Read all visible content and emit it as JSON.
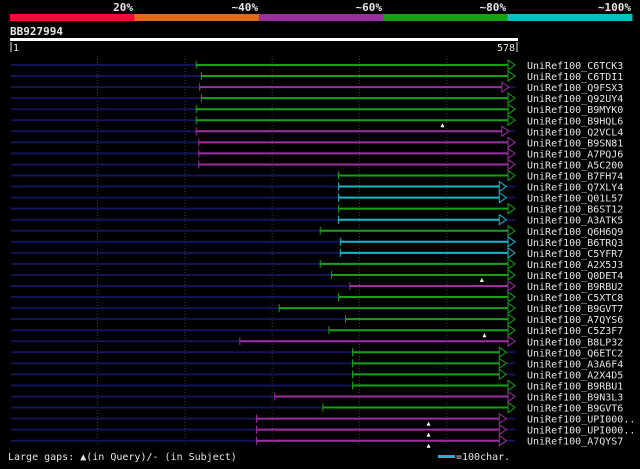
{
  "header": {
    "identity_ticks": [
      "20%",
      "~40%",
      "~60%",
      "~80%",
      "~100%"
    ],
    "identity_colors": [
      "#e8103a",
      "#e06c1c",
      "#9b2fa0",
      "#16a016",
      "#16b8c4"
    ],
    "query_id": "BB927994",
    "query_start": "1",
    "query_end": "578"
  },
  "footer": {
    "gaps_legend": "Large gaps: ▲(in Query)/- (in Subject)",
    "scale_legend": "=100char."
  },
  "colors": {
    "background": "#000000",
    "baseline": "#14145a",
    "grid": "#3a3a3a",
    "text": "#e6e6e6",
    "green": "#16a016",
    "purple": "#9b2fa0",
    "cyan": "#16b8c4"
  },
  "chart_data": {
    "type": "alignment",
    "query_length": 578,
    "x_range": [
      1,
      578
    ],
    "grid": true,
    "identity_bins": [
      "20%",
      "~40%",
      "~60%",
      "~80%",
      "~100%"
    ],
    "hits": [
      {
        "name": "UniRef100_C6TCK3",
        "start": 213,
        "end": 578,
        "color": "green",
        "gaps": []
      },
      {
        "name": "UniRef100_C6TDI1",
        "start": 219,
        "end": 578,
        "color": "green",
        "gaps": []
      },
      {
        "name": "UniRef100_Q9FSX3",
        "start": 217,
        "end": 571,
        "color": "purple",
        "gaps": []
      },
      {
        "name": "UniRef100_Q92UY4",
        "start": 219,
        "end": 578,
        "color": "green",
        "gaps": []
      },
      {
        "name": "UniRef100_B9MYK0",
        "start": 213,
        "end": 578,
        "color": "green",
        "gaps": []
      },
      {
        "name": "UniRef100_B9HQL6",
        "start": 213,
        "end": 578,
        "color": "green",
        "gaps": [
          495
        ]
      },
      {
        "name": "UniRef100_Q2VCL4",
        "start": 213,
        "end": 571,
        "color": "purple",
        "gaps": []
      },
      {
        "name": "UniRef100_B9SN81",
        "start": 216,
        "end": 578,
        "color": "purple",
        "gaps": []
      },
      {
        "name": "UniRef100_A7PQJ6",
        "start": 216,
        "end": 578,
        "color": "purple",
        "gaps": []
      },
      {
        "name": "UniRef100_A5C200",
        "start": 216,
        "end": 578,
        "color": "purple",
        "gaps": []
      },
      {
        "name": "UniRef100_B7FH74",
        "start": 376,
        "end": 578,
        "color": "green",
        "gaps": []
      },
      {
        "name": "UniRef100_Q7XLY4",
        "start": 376,
        "end": 568,
        "color": "cyan",
        "gaps": []
      },
      {
        "name": "UniRef100_Q01L57",
        "start": 376,
        "end": 568,
        "color": "cyan",
        "gaps": []
      },
      {
        "name": "UniRef100_B6ST12",
        "start": 376,
        "end": 578,
        "color": "green",
        "gaps": []
      },
      {
        "name": "UniRef100_A3ATK5",
        "start": 376,
        "end": 568,
        "color": "cyan",
        "gaps": []
      },
      {
        "name": "UniRef100_Q6H6Q9",
        "start": 355,
        "end": 578,
        "color": "green",
        "gaps": []
      },
      {
        "name": "UniRef100_B6TRQ3",
        "start": 378,
        "end": 578,
        "color": "cyan",
        "gaps": []
      },
      {
        "name": "UniRef100_C5YFR7",
        "start": 378,
        "end": 578,
        "color": "cyan",
        "gaps": []
      },
      {
        "name": "UniRef100_A2X5J3",
        "start": 355,
        "end": 578,
        "color": "green",
        "gaps": []
      },
      {
        "name": "UniRef100_Q0DET4",
        "start": 368,
        "end": 578,
        "color": "green",
        "gaps": [
          540
        ]
      },
      {
        "name": "UniRef100_B9RBU2",
        "start": 389,
        "end": 578,
        "color": "purple",
        "gaps": []
      },
      {
        "name": "UniRef100_C5XTC8",
        "start": 376,
        "end": 578,
        "color": "green",
        "gaps": []
      },
      {
        "name": "UniRef100_B9GVT7",
        "start": 308,
        "end": 578,
        "color": "green",
        "gaps": []
      },
      {
        "name": "UniRef100_A7QYS6",
        "start": 384,
        "end": 578,
        "color": "green",
        "gaps": []
      },
      {
        "name": "UniRef100_C5Z3F7",
        "start": 365,
        "end": 578,
        "color": "green",
        "gaps": [
          543
        ]
      },
      {
        "name": "UniRef100_B8LP32",
        "start": 263,
        "end": 578,
        "color": "purple",
        "gaps": []
      },
      {
        "name": "UniRef100_Q6ETC2",
        "start": 392,
        "end": 568,
        "color": "green",
        "gaps": []
      },
      {
        "name": "UniRef100_A3A6F4",
        "start": 392,
        "end": 568,
        "color": "green",
        "gaps": []
      },
      {
        "name": "UniRef100_A2X4D5",
        "start": 392,
        "end": 568,
        "color": "green",
        "gaps": []
      },
      {
        "name": "UniRef100_B9RBU1",
        "start": 392,
        "end": 578,
        "color": "green",
        "gaps": []
      },
      {
        "name": "UniRef100_B9N3L3",
        "start": 303,
        "end": 578,
        "color": "purple",
        "gaps": []
      },
      {
        "name": "UniRef100_B9GVT6",
        "start": 358,
        "end": 578,
        "color": "green",
        "gaps": []
      },
      {
        "name": "UniRef100_UPI000..",
        "start": 282,
        "end": 568,
        "color": "purple",
        "gaps": [
          479
        ]
      },
      {
        "name": "UniRef100_UPI000..",
        "start": 282,
        "end": 568,
        "color": "purple",
        "gaps": [
          479
        ]
      },
      {
        "name": "UniRef100_A7QYS7",
        "start": 282,
        "end": 568,
        "color": "purple",
        "gaps": [
          479
        ]
      }
    ]
  }
}
